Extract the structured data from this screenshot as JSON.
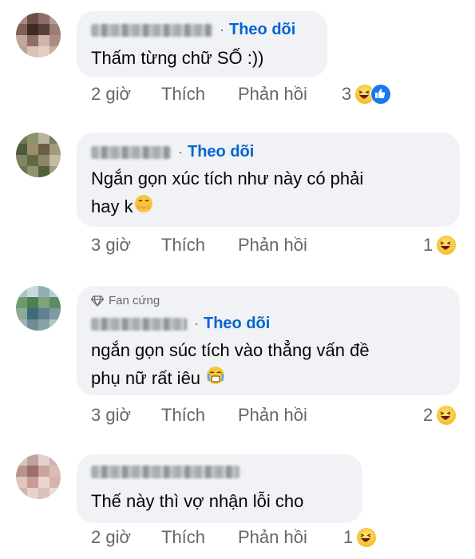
{
  "follow_label": "Theo dõi",
  "actions": {
    "like": "Thích",
    "reply": "Phản hồi"
  },
  "colors": {
    "follow": "#0064d1",
    "bubble": "#f0f2f5",
    "meta": "#65676b"
  },
  "comments": [
    {
      "text_lines": [
        "Thấm từng chữ SỐ :))"
      ],
      "time": "2 giờ",
      "reaction_count": "3",
      "reactions": [
        "haha-emoji-icon",
        "like-reaction-icon"
      ]
    },
    {
      "text_lines": [
        "Ngắn gọn xúc tích như này có phải",
        "hay k"
      ],
      "inline_emoji": "laugh-cover-mouth-emoji-icon",
      "time": "3 giờ",
      "reaction_count": "1",
      "reactions": [
        "haha-emoji-icon"
      ]
    },
    {
      "badge": "Fan cứng",
      "text_lines": [
        "ngắn gọn súc tích vào thẳng vấn đề",
        "phụ nữ rất iêu"
      ],
      "inline_emoji": "crying-laugh-emoji-icon",
      "time": "3 giờ",
      "reaction_count": "2",
      "reactions": [
        "haha-emoji-icon"
      ]
    },
    {
      "text_lines": [
        "Thế này thì vợ nhận lỗi cho"
      ],
      "time": "2 giờ",
      "reaction_count": "1",
      "reactions": [
        "haha-emoji-icon"
      ]
    }
  ]
}
